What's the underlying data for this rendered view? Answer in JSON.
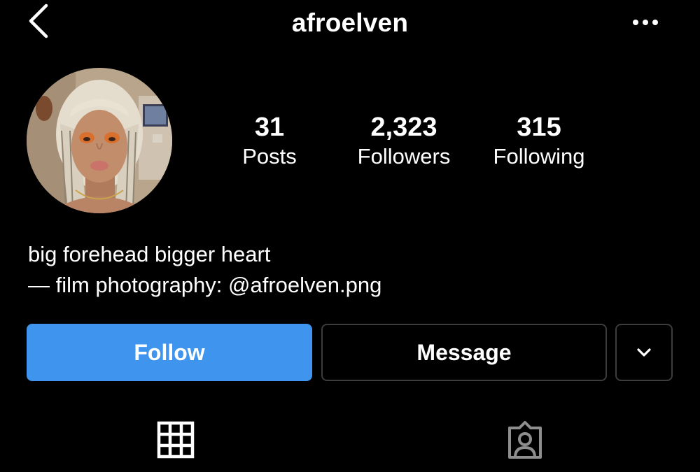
{
  "header": {
    "username": "afroelven",
    "back_icon": "chevron-left-icon",
    "more_icon": "more-horizontal-icon"
  },
  "profile": {
    "avatar_icon": "profile-photo"
  },
  "stats": {
    "posts_count": "31",
    "posts_label": "Posts",
    "followers_count": "2,323",
    "followers_label": "Followers",
    "following_count": "315",
    "following_label": "Following"
  },
  "bio": {
    "line1": "big forehead bigger heart",
    "line2": "— film photography: @afroelven.png"
  },
  "actions": {
    "follow_label": "Follow",
    "message_label": "Message",
    "dropdown_icon": "chevron-down-icon"
  },
  "tabs": [
    {
      "name": "posts-grid",
      "icon": "grid-icon"
    },
    {
      "name": "tagged",
      "icon": "tagged-person-icon"
    }
  ],
  "colors": {
    "background": "#000000",
    "text": "#ffffff",
    "follow_button": "#3f94ee",
    "button_border": "#3c3c3c",
    "inactive_tab_icon": "#8e8e8e"
  }
}
